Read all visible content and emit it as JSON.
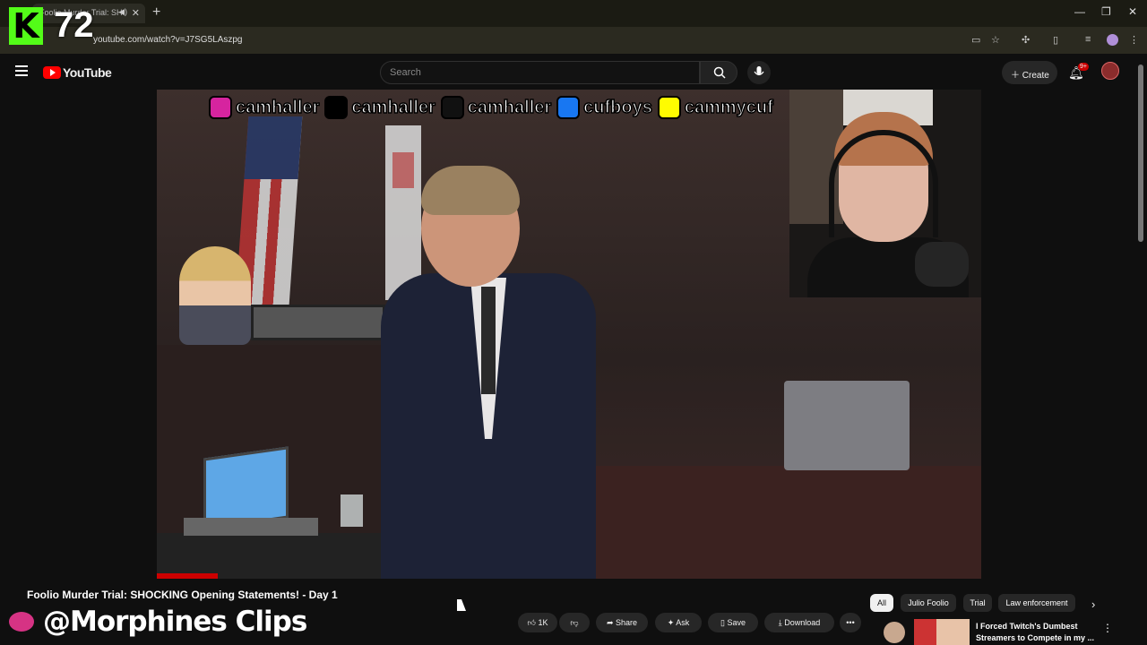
{
  "browser": {
    "tab_title": "Foolio Murder Trial: SH",
    "url": "youtube.com/watch?v=J7SG5LAszpg"
  },
  "overlay": {
    "kick_logo": "K",
    "viewer_count": "72",
    "channel_watermark": "@Morphines Clips"
  },
  "header": {
    "logo_text": "YouTube",
    "search_placeholder": "Search",
    "create_label": "Create",
    "notification_badge": "9+"
  },
  "video": {
    "socials": [
      {
        "icon": "instagram-icon",
        "handle": "camhaller",
        "color": "#d6249f"
      },
      {
        "icon": "x-icon",
        "handle": "camhaller",
        "color": "#000000"
      },
      {
        "icon": "tiktok-icon",
        "handle": "camhaller",
        "color": "#111111"
      },
      {
        "icon": "facebook-icon",
        "handle": "cufboys",
        "color": "#1877f2"
      },
      {
        "icon": "snapchat-icon",
        "handle": "cammycuf",
        "color": "#fffc00"
      }
    ],
    "title": "Foolio Murder Trial: SHOCKING Opening Statements! - Day 1"
  },
  "actions": {
    "like_count": "1K",
    "share": "Share",
    "ask": "Ask",
    "save": "Save",
    "download": "Download"
  },
  "chips": [
    "All",
    "Julio Foolio",
    "Trial",
    "Law enforcement"
  ],
  "related": {
    "title": "I Forced Twitch's Dumbest Streamers to Compete in my ..."
  },
  "colors": {
    "accent": "#ff0000",
    "kick": "#53fc18"
  }
}
